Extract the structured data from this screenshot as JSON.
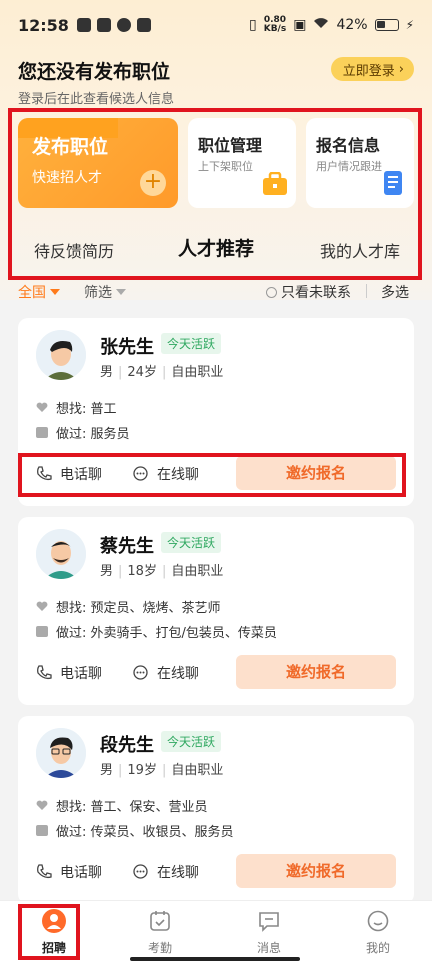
{
  "status_bar": {
    "time": "12:58",
    "net_speed_value": "0.80",
    "net_speed_unit": "KB/s",
    "battery": "42%"
  },
  "header": {
    "title": "您还没有发布职位",
    "subtitle": "登录后在此查看候选人信息",
    "login_button": "立即登录"
  },
  "actions": {
    "post_job": {
      "title": "发布职位",
      "subtitle": "快速招人才"
    },
    "job_manage": {
      "title": "职位管理",
      "subtitle": "上下架职位"
    },
    "signup_info": {
      "title": "报名信息",
      "subtitle": "用户情况跟进"
    }
  },
  "tabs": [
    "待反馈简历",
    "人才推荐",
    "我的人才库"
  ],
  "filters": {
    "all": "全国",
    "screen": "筛选",
    "unseen": "只看未联系",
    "multi": "多选"
  },
  "candidates": [
    {
      "name": "张先生",
      "badge": "今天活跃",
      "gender": "男",
      "age": "24岁",
      "job_status": "自由职业",
      "want_label": "想找:",
      "want": "普工",
      "done_label": "做过:",
      "done": "服务员",
      "phone": "电话聊",
      "chat": "在线聊",
      "invite": "邀约报名"
    },
    {
      "name": "蔡先生",
      "badge": "今天活跃",
      "gender": "男",
      "age": "18岁",
      "job_status": "自由职业",
      "want_label": "想找:",
      "want": "预定员、烧烤、茶艺师",
      "done_label": "做过:",
      "done": "外卖骑手、打包/包装员、传菜员",
      "phone": "电话聊",
      "chat": "在线聊",
      "invite": "邀约报名"
    },
    {
      "name": "段先生",
      "badge": "今天活跃",
      "gender": "男",
      "age": "19岁",
      "job_status": "自由职业",
      "want_label": "想找:",
      "want": "普工、保安、营业员",
      "done_label": "做过:",
      "done": "传菜员、收银员、服务员",
      "phone": "电话聊",
      "chat": "在线聊",
      "invite": "邀约报名"
    }
  ],
  "bottom_nav": [
    "招聘",
    "考勤",
    "消息",
    "我的"
  ],
  "colors": {
    "accent": "#ff7a1a",
    "highlight_box": "#e0141e",
    "active_badge": "#2fa860"
  }
}
